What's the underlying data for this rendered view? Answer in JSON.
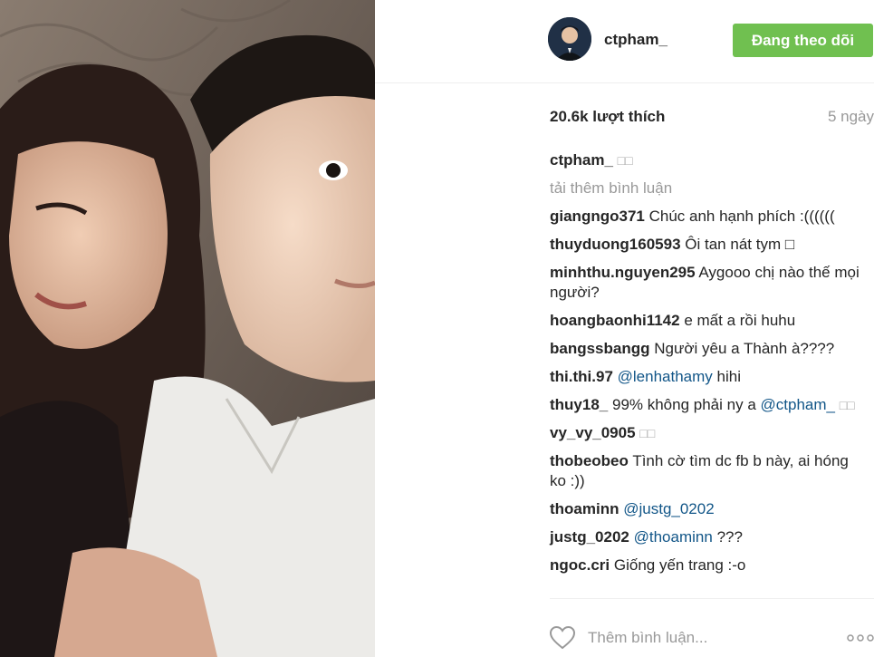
{
  "post": {
    "author": "ctpham_",
    "follow_label": "Đang theo dõi",
    "likes": "20.6k lượt thích",
    "time": "5 ngày",
    "caption": {
      "user": "ctpham_",
      "text": "□□"
    },
    "load_more": "tải thêm bình luận",
    "comment_placeholder": "Thêm bình luận...",
    "accent_color": "#70c050",
    "link_color": "#125688"
  },
  "comments": [
    {
      "user": "giangngo371",
      "text": "Chúc anh hạnh phích :(((((("
    },
    {
      "user": "thuyduong160593",
      "text": "Ôi tan nát tym □"
    },
    {
      "user": "minhthu.nguyen295",
      "text": "Aygooo chị nào thế mọi người?"
    },
    {
      "user": "hoangbaonhi1142",
      "text": "e mất a rồi huhu"
    },
    {
      "user": "bangssbangg",
      "text": "Người yêu a Thành à????"
    },
    {
      "user": "thi.thi.97",
      "mention": "@lenhathamy",
      "text": "hihi"
    },
    {
      "user": "thuy18_",
      "text": "99% không phải ny a",
      "mention": "@ctpham_",
      "trail": "□□"
    },
    {
      "user": "vy_vy_0905",
      "text": "□□"
    },
    {
      "user": "thobeobeo",
      "text": "Tình cờ tìm dc fb b này, ai hóng ko :))"
    },
    {
      "user": "thoaminn",
      "mention": "@justg_0202",
      "text": ""
    },
    {
      "user": "justg_0202",
      "mention": "@thoaminn",
      "text": "???"
    },
    {
      "user": "ngoc.cri",
      "text": "Giống yến trang :-o"
    }
  ]
}
